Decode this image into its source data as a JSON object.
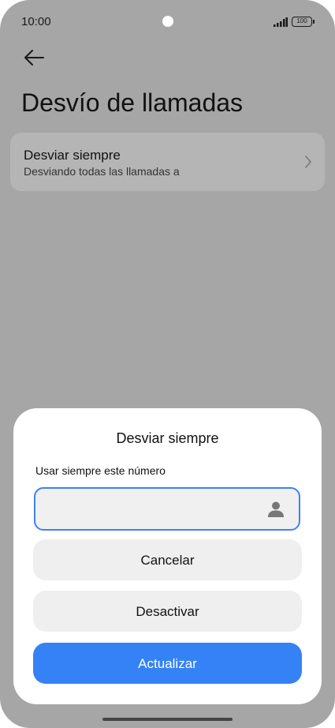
{
  "status_bar": {
    "time": "10:00",
    "battery": "100"
  },
  "page": {
    "title": "Desvío de llamadas"
  },
  "setting": {
    "title": "Desviar siempre",
    "subtitle": "Desviando todas las llamadas a"
  },
  "dialog": {
    "title": "Desviar siempre",
    "field_label": "Usar siempre este número",
    "number_value": "",
    "cancel_label": "Cancelar",
    "deactivate_label": "Desactivar",
    "update_label": "Actualizar"
  },
  "colors": {
    "accent": "#3482f6",
    "overlay": "#a6a6a6",
    "sheet": "#ffffff"
  },
  "icons": {
    "back": "arrow-left-icon",
    "chevron": "chevron-right-icon",
    "contact": "person-icon"
  }
}
